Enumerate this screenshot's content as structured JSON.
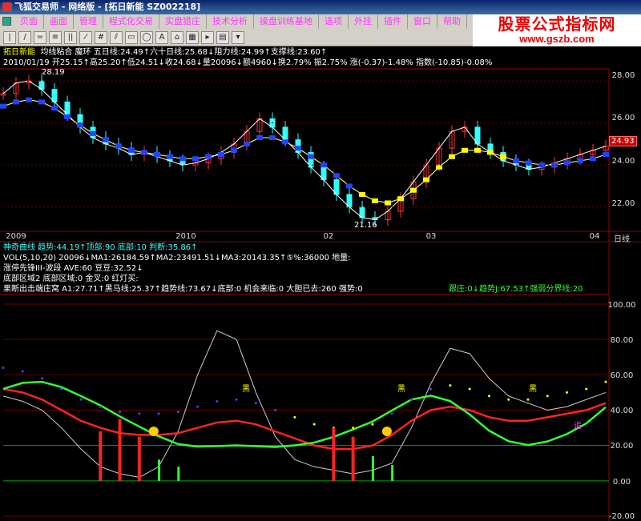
{
  "window": {
    "title": "飞狐交易师 - 网络版 - [拓日新能 SZ002218]"
  },
  "menu": [
    "页面",
    "画面",
    "管理",
    "程式化交易",
    "实盘猎庄",
    "技术分析",
    "操盘训练基地",
    "选项",
    "外挂",
    "插件",
    "窗口",
    "帮助"
  ],
  "toolbar": [
    "|",
    "/",
    "=",
    "≡",
    "||",
    "⁄",
    "#",
    "⫽",
    "▭",
    "◯",
    "A",
    "⌂",
    "▦",
    "▸",
    "▤",
    "▾"
  ],
  "banner": {
    "line1": "股票公式指标网",
    "line2": "www.gszb.com"
  },
  "chart_header": {
    "name": "拓日新能",
    "indicators": "均线粘合  魔环  五日线:24.49↑六十日线:25.68↓阻力线:24.99↑支撑线:23.60↑"
  },
  "quote_line": "2010/01/19 开25.15↑高25.20↑低24.51↓收24.68↓量20096↓额4960↓换2.79% 振2.75% 涨(-0.37)-1.48% 指数(-10.85)-0.08%",
  "price_axis": [
    "28.00",
    "26.00",
    "24.00",
    "22.00"
  ],
  "price_tag": "24.93",
  "high_label": "28.19",
  "low_label": "21.16",
  "date_axis": [
    "2009",
    "2010",
    "02",
    "03",
    "04",
    "日线"
  ],
  "sub_lines": {
    "line1": "神奇曲线  趋势:44.19↑顶部:90  底部:10  判断:35.86↑",
    "line2": "VOL(5,10,20)  20096↓MA1:26184.59↑MA2:23491.51↓MA3:20143.35↑⑤%:36000  地量:",
    "line3": "涨停先锋III-波段  AVE:60  豆豆:32.52↓",
    "line4": "底部区域2  底部区域:0  金叉:0  红灯买:",
    "line5a": "果断出击端庄窝  A1:27.71↑黑马线:25.37↑趋势线:73.67↓底部:0  机会来临:0  大胆已去:260  强势:0",
    "line5b": "跟庄:0↓趋势J:67.53↑强弱分界线:20"
  },
  "osc_axis": [
    "100.00",
    "80.00",
    "60.00",
    "40.00",
    "20.00",
    "0.00",
    "-20.00"
  ],
  "osc_labels": [
    "黑",
    "黑",
    "黑",
    "追"
  ],
  "colors": {
    "up": "#ff3333",
    "down": "#33ffff",
    "ma5": "#ffffff",
    "ma60": "#f0e68c",
    "blue": "#2244ff",
    "green": "#33ff33"
  },
  "chart_data": [
    {
      "type": "line",
      "title": "拓日新能",
      "ylim": [
        21.0,
        28.5
      ],
      "series": [
        {
          "name": "收盘",
          "values": [
            27.4,
            27.9,
            28.0,
            27.6,
            27.0,
            26.4,
            25.8,
            25.3,
            25.0,
            24.8,
            24.5,
            24.6,
            24.4,
            24.2,
            24.0,
            24.1,
            24.3,
            24.6,
            25.0,
            25.6,
            26.2,
            25.8,
            25.2,
            24.6,
            23.9,
            23.3,
            22.6,
            22.0,
            21.5,
            21.4,
            21.8,
            22.4,
            23.2,
            24.0,
            24.8,
            25.6,
            25.8,
            25.0,
            24.6,
            24.2,
            24.0,
            23.8,
            23.9,
            24.1,
            24.3,
            24.5,
            24.7,
            24.9
          ]
        },
        {
          "name": "均线",
          "values": [
            26.8,
            27.0,
            27.1,
            27.0,
            26.7,
            26.3,
            25.9,
            25.5,
            25.2,
            24.9,
            24.7,
            24.6,
            24.5,
            24.4,
            24.3,
            24.3,
            24.4,
            24.5,
            24.7,
            25.0,
            25.3,
            25.3,
            25.1,
            24.8,
            24.4,
            24.0,
            23.5,
            23.0,
            22.6,
            22.3,
            22.2,
            22.4,
            22.8,
            23.3,
            23.9,
            24.4,
            24.7,
            24.7,
            24.6,
            24.4,
            24.2,
            24.1,
            24.0,
            24.0,
            24.1,
            24.2,
            24.3,
            24.5
          ]
        }
      ]
    },
    {
      "type": "line",
      "ylim": [
        -20,
        100
      ],
      "series": [
        {
          "name": "趋势",
          "values": [
            48,
            45,
            40,
            30,
            18,
            8,
            4,
            2,
            8,
            28,
            60,
            85,
            80,
            50,
            25,
            12,
            8,
            6,
            4,
            6,
            10,
            30,
            55,
            75,
            72,
            58,
            48,
            44,
            40,
            42,
            46,
            50
          ]
        },
        {
          "name": "黑马线",
          "values": [
            52,
            50,
            46,
            40,
            34,
            30,
            27,
            26,
            26,
            27,
            30,
            33,
            34,
            32,
            28,
            24,
            20,
            18,
            18,
            20,
            26,
            34,
            40,
            42,
            40,
            36,
            34,
            34,
            36,
            38,
            40,
            44
          ]
        },
        {
          "name": "强弱分界线",
          "values": [
            20,
            20,
            20,
            20,
            20,
            20,
            20,
            20,
            20,
            20,
            20,
            20,
            20,
            20,
            20,
            20,
            20,
            20,
            20,
            20,
            20,
            20,
            20,
            20,
            20,
            20,
            20,
            20,
            20,
            20,
            20,
            20
          ]
        }
      ]
    }
  ]
}
